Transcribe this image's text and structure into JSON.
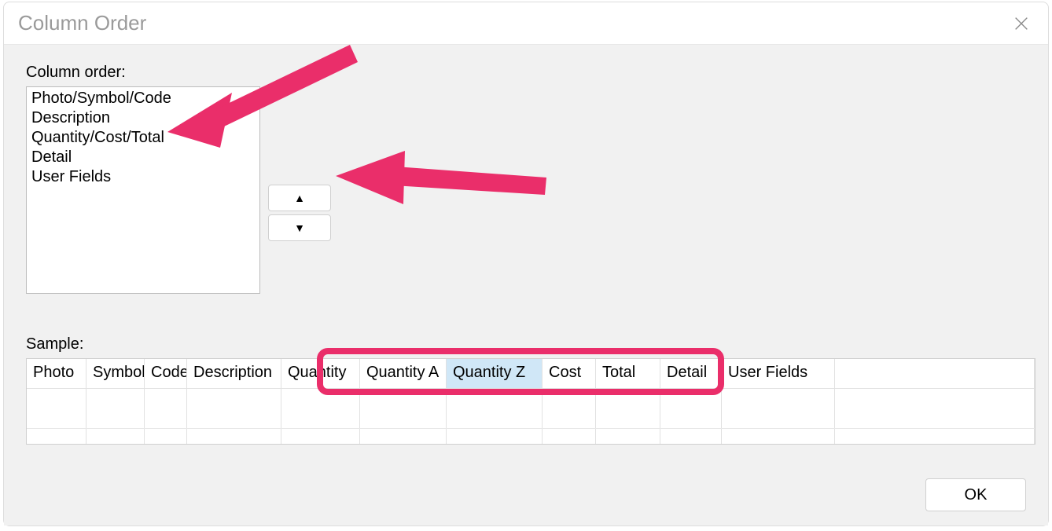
{
  "dialog": {
    "title": "Column Order",
    "column_order_label": "Column order:",
    "items": [
      "Photo/Symbol/Code",
      "Description",
      "Quantity/Cost/Total",
      "Detail",
      "User Fields"
    ],
    "sample_label": "Sample:",
    "sample_headers": [
      "Photo",
      "Symbol",
      "Code",
      "Description",
      "Quantity",
      "Quantity A",
      "Quantity Z",
      "Cost",
      "Total",
      "Detail",
      "User Fields",
      ""
    ],
    "highlighted_header_index": 6,
    "highlight_group_start": 4,
    "highlight_group_end": 8,
    "ok_label": "OK",
    "icons": {
      "up": "▲",
      "down": "▼"
    },
    "annotation_color": "#ea2e6a"
  }
}
